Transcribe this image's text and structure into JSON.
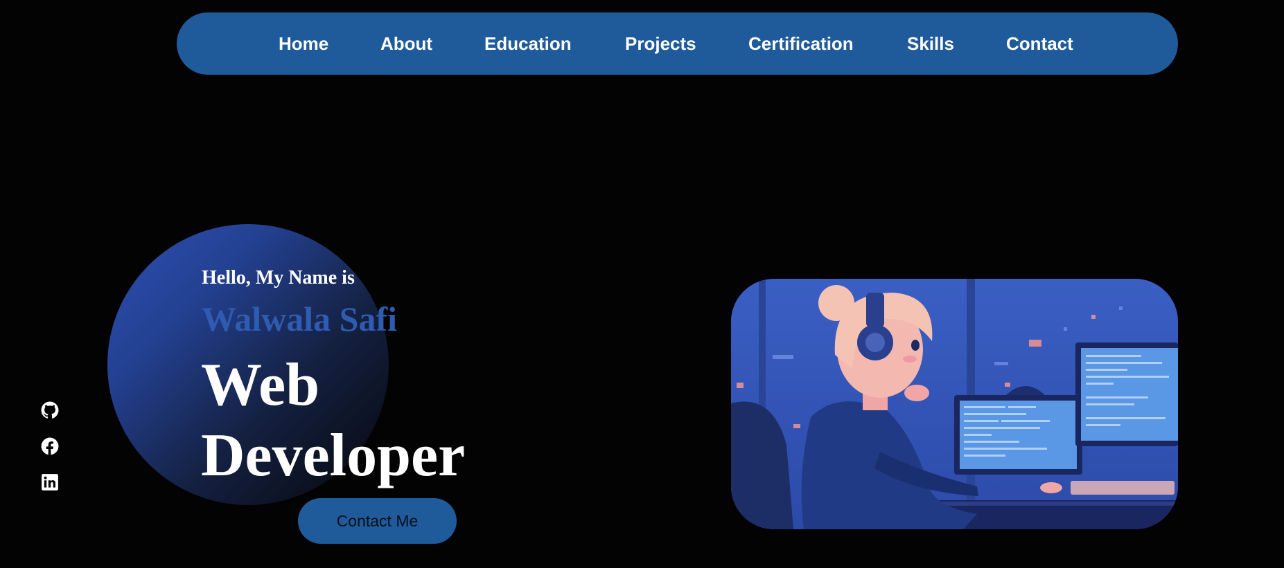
{
  "nav": {
    "items": [
      {
        "label": "Home"
      },
      {
        "label": "About"
      },
      {
        "label": "Education"
      },
      {
        "label": "Projects"
      },
      {
        "label": "Certification"
      },
      {
        "label": "Skills"
      },
      {
        "label": "Contact"
      }
    ]
  },
  "hero": {
    "greeting": "Hello, My Name is",
    "name": "Walwala Safi",
    "role_line1": "Web",
    "role_line2": "Developer",
    "cta_label": "Contact Me"
  },
  "social": {
    "links": [
      {
        "icon": "github-icon"
      },
      {
        "icon": "facebook-icon"
      },
      {
        "icon": "linkedin-icon"
      }
    ]
  },
  "illustration": {
    "subject": "lofi-girl-coding-illustration"
  },
  "colors": {
    "background": "#030303",
    "nav_bg": "#1f5b9a",
    "accent_name": "#2f5bb1",
    "text": "#ffffff"
  }
}
